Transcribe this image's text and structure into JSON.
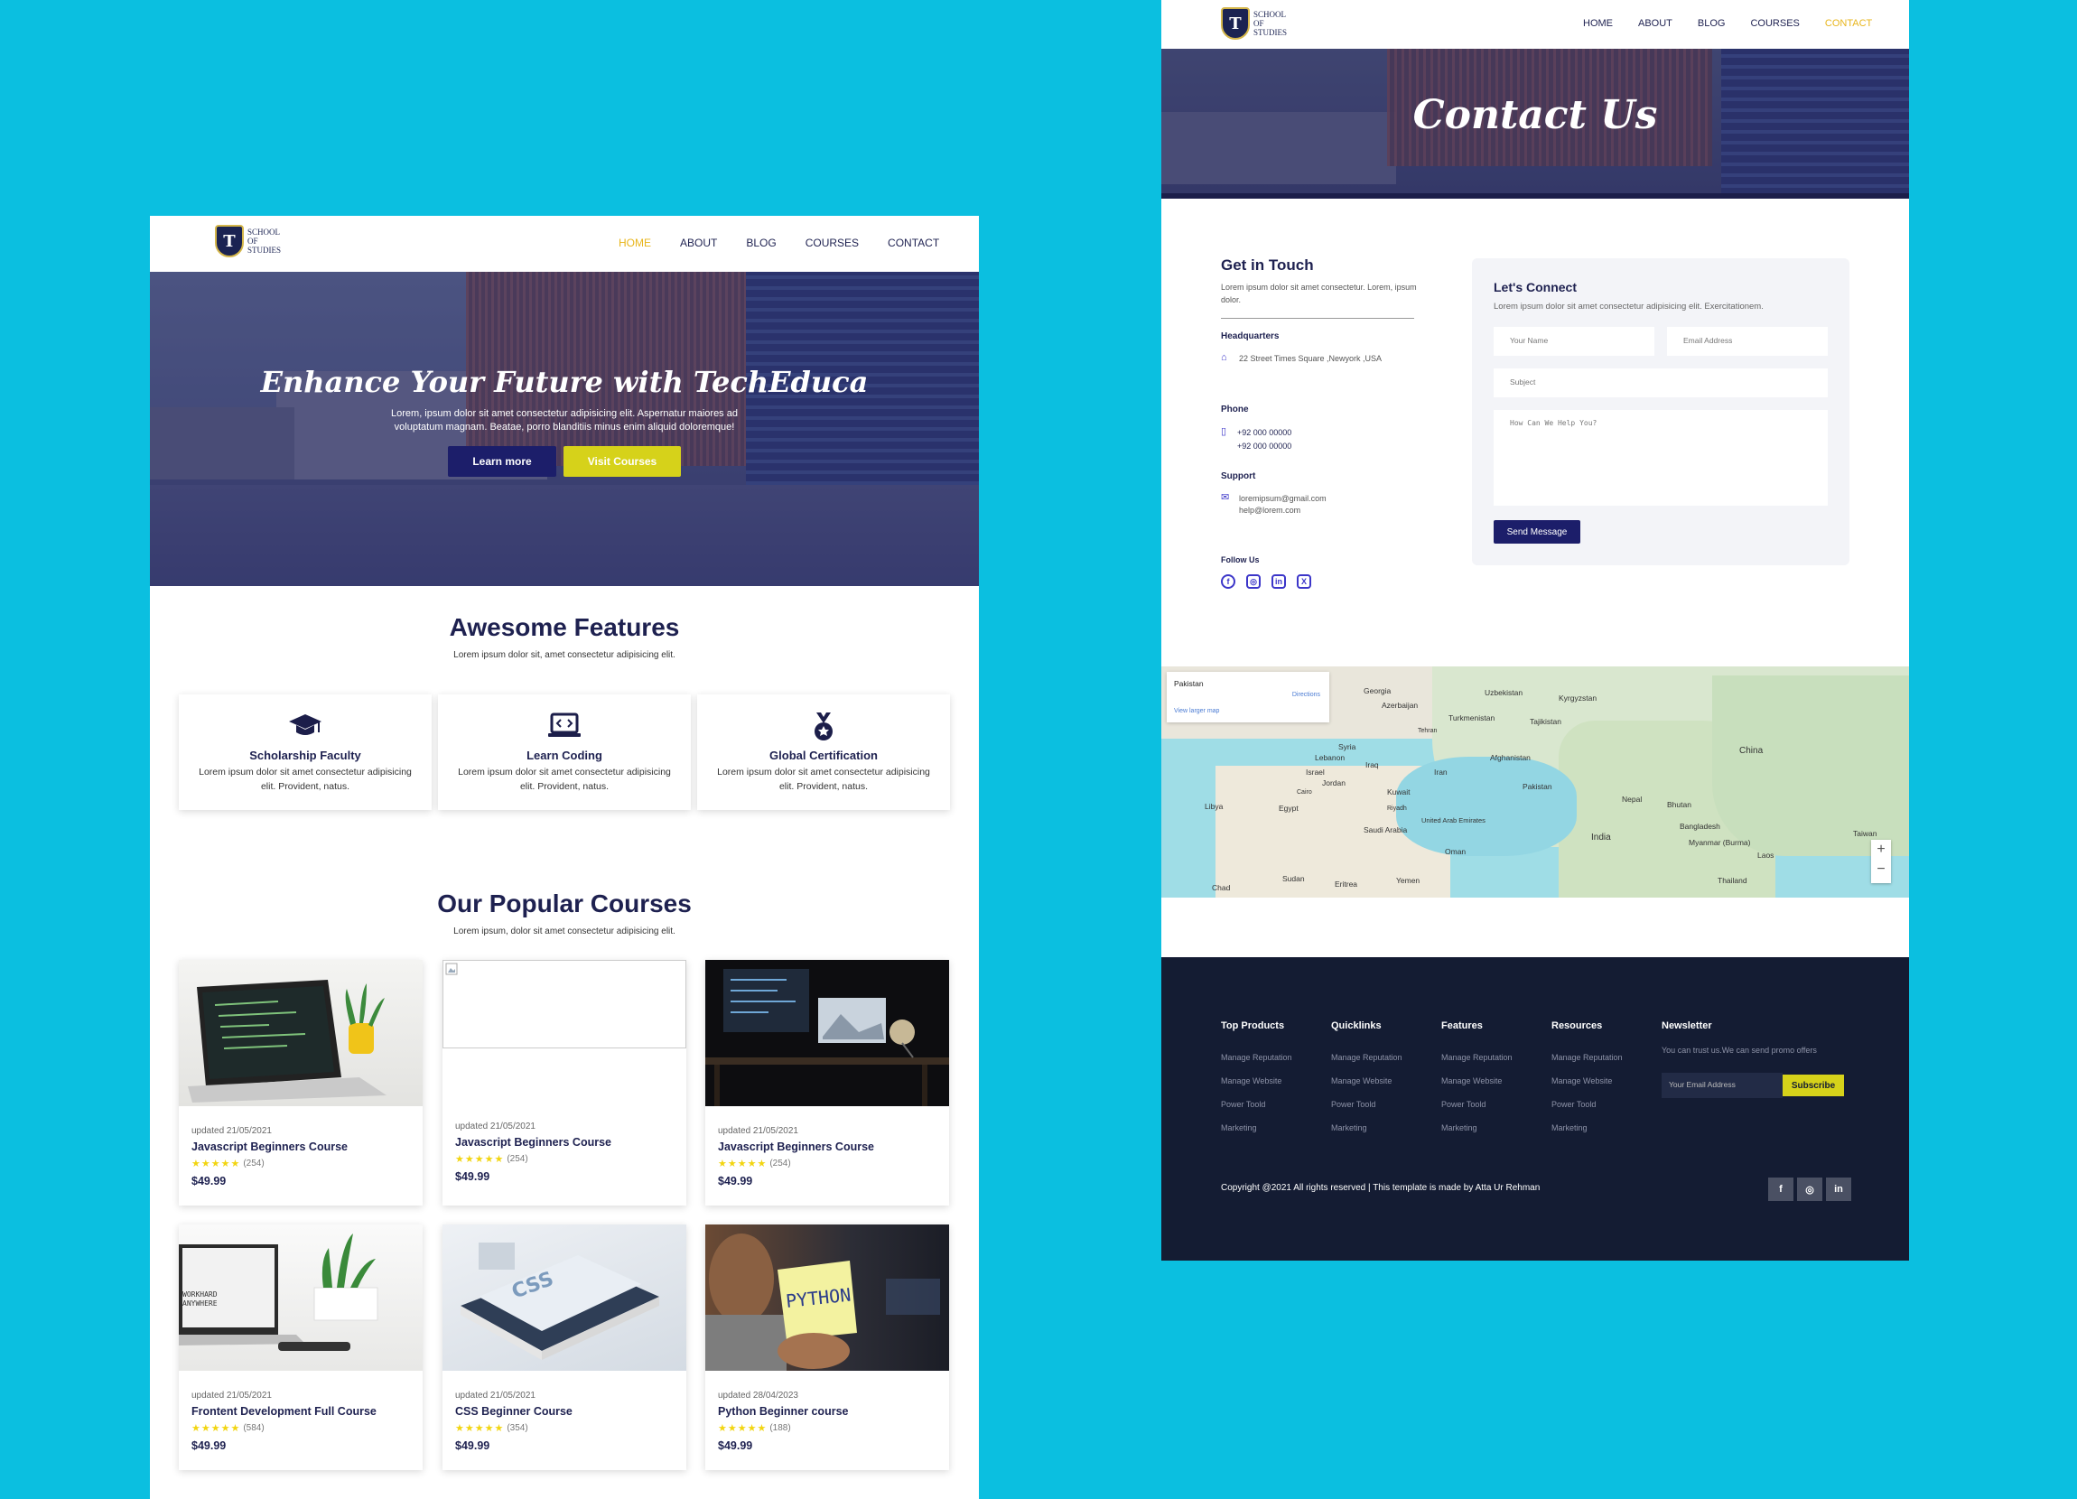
{
  "brand": {
    "logo_letter": "T",
    "logo_text_1": "SCHOOL",
    "logo_text_2": "OF",
    "logo_text_3": "STUDIES"
  },
  "home": {
    "nav": [
      "HOME",
      "ABOUT",
      "BLOG",
      "COURSES",
      "CONTACT"
    ],
    "active_nav": "HOME",
    "hero": {
      "title": "Enhance Your Future with TechEduca",
      "text": "Lorem, ipsum dolor sit amet consectetur adipisicing elit. Aspernatur maiores ad voluptatum magnam. Beatae, porro blanditiis minus enim aliquid doloremque!",
      "btn_learn": "Learn more",
      "btn_courses": "Visit Courses"
    },
    "features": {
      "title": "Awesome Features",
      "subtitle": "Lorem ipsum dolor sit, amet consectetur adipisicing elit.",
      "items": [
        {
          "icon": "graduation-cap-icon",
          "title": "Scholarship Faculty",
          "text": "Lorem ipsum dolor sit amet consectetur adipisicing elit. Provident, natus."
        },
        {
          "icon": "laptop-code-icon",
          "title": "Learn Coding",
          "text": "Lorem ipsum dolor sit amet consectetur adipisicing elit. Provident, natus."
        },
        {
          "icon": "medal-icon",
          "title": "Global Certification",
          "text": "Lorem ipsum dolor sit amet consectetur adipisicing elit. Provident, natus."
        }
      ]
    },
    "courses": {
      "title": "Our Popular Courses",
      "subtitle": "Lorem ipsum, dolor sit amet consectetur adipisicing elit.",
      "items": [
        {
          "date": "updated 21/05/2021",
          "name": "Javascript Beginners Course",
          "stars": "★★★★★",
          "reviews": "(254)",
          "price": "$49.99"
        },
        {
          "date": "updated 21/05/2021",
          "name": "Javascript Beginners Course",
          "stars": "★★★★★",
          "reviews": "(254)",
          "price": "$49.99"
        },
        {
          "date": "updated 21/05/2021",
          "name": "Javascript Beginners Course",
          "stars": "★★★★★",
          "reviews": "(254)",
          "price": "$49.99"
        },
        {
          "date": "updated 21/05/2021",
          "name": "Frontent Development Full Course",
          "stars": "★★★★★",
          "reviews": "(584)",
          "price": "$49.99"
        },
        {
          "date": "updated 21/05/2021",
          "name": "CSS Beginner Course",
          "stars": "★★★★★",
          "reviews": "(354)",
          "price": "$49.99"
        },
        {
          "date": "updated 28/04/2023",
          "name": "Python Beginner course",
          "stars": "★★★★★",
          "reviews": "(188)",
          "price": "$49.99"
        }
      ]
    }
  },
  "contact": {
    "nav": [
      "HOME",
      "ABOUT",
      "BLOG",
      "COURSES",
      "CONTACT"
    ],
    "active_nav": "CONTACT",
    "hero_title": "Contact Us",
    "get_in_touch": {
      "title": "Get in Touch",
      "text": "Lorem ipsum dolor sit amet consectetur. Lorem, ipsum dolor.",
      "hq_label": "Headquarters",
      "hq_value": "22 Street Times Square ,Newyork ,USA",
      "phone_label": "Phone",
      "phone_1": "+92 000 00000",
      "phone_2": "+92 000 00000",
      "support_label": "Support",
      "email_1": "loremipsum@gmail.com",
      "email_2": "help@lorem.com",
      "follow_label": "Follow Us"
    },
    "form": {
      "title": "Let's Connect",
      "text": "Lorem ipsum dolor sit amet consectetur adipisicing elit. Exercitationem.",
      "name_placeholder": "Your Name",
      "email_placeholder": "Email Address",
      "subject_placeholder": "Subject",
      "message_placeholder": "How Can We Help You?",
      "submit": "Send Message"
    },
    "map": {
      "place": "Pakistan",
      "directions": "Directions",
      "larger": "View larger map",
      "labels": [
        "Georgia",
        "Azerbaijan",
        "Uzbekistan",
        "Kyrgyzstan",
        "Turkmenistan",
        "Tajikistan",
        "Afghanistan",
        "Pakistan",
        "China",
        "Nepal",
        "Bhutan",
        "Bangladesh",
        "India",
        "Myanmar (Burma)",
        "Laos",
        "Thailand",
        "Taiwan",
        "Syria",
        "Lebanon",
        "Iraq",
        "Iran",
        "Israel",
        "Jordan",
        "Kuwait",
        "Egypt",
        "Libya",
        "Saudi Arabia",
        "United Arab Emirates",
        "Oman",
        "Sudan",
        "Eritrea",
        "Yemen",
        "Chad",
        "Tehran",
        "Riyadh",
        "Cairo"
      ]
    },
    "footer": {
      "columns": [
        {
          "title": "Top Products",
          "items": [
            "Manage Reputation",
            "Manage Website",
            "Power Toold",
            "Marketing"
          ]
        },
        {
          "title": "Quicklinks",
          "items": [
            "Manage Reputation",
            "Manage Website",
            "Power Toold",
            "Marketing"
          ]
        },
        {
          "title": "Features",
          "items": [
            "Manage Reputation",
            "Manage Website",
            "Power Toold",
            "Marketing"
          ]
        },
        {
          "title": "Resources",
          "items": [
            "Manage Reputation",
            "Manage Website",
            "Power Toold",
            "Marketing"
          ]
        }
      ],
      "newsletter_title": "Newsletter",
      "newsletter_text": "You can trust us.We can send promo offers",
      "email_placeholder": "Your Email Address",
      "subscribe": "Subscribe",
      "copyright": "Copyright @2021 All rights reserved | This template is made by Atta Ur Rehman",
      "social": [
        "f",
        "◎",
        "in"
      ]
    }
  },
  "colors": {
    "background": "#0bbfe0",
    "navy": "#1c1e6a",
    "yellow": "#d6d21a",
    "active_nav": "#e8b51b",
    "footer": "#141c33"
  }
}
